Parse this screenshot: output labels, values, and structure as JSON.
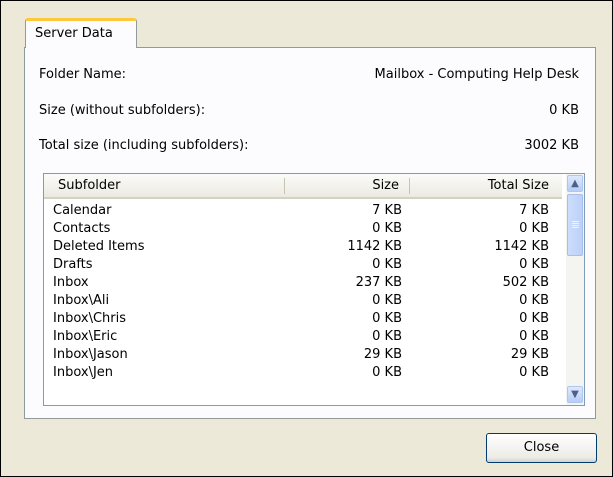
{
  "tab": {
    "label": "Server Data"
  },
  "info": {
    "folder_name_label": "Folder Name:",
    "folder_name_value": "Mailbox - Computing Help Desk",
    "size_label": "Size (without subfolders):",
    "size_value": "0 KB",
    "total_size_label": "Total size (including subfolders):",
    "total_size_value": "3002 KB"
  },
  "table": {
    "headers": {
      "subfolder": "Subfolder",
      "size": "Size",
      "total_size": "Total Size"
    },
    "rows": [
      {
        "name": "Calendar",
        "size": "7 KB",
        "total": "7 KB"
      },
      {
        "name": "Contacts",
        "size": "0 KB",
        "total": "0 KB"
      },
      {
        "name": "Deleted Items",
        "size": "1142 KB",
        "total": "1142 KB"
      },
      {
        "name": "Drafts",
        "size": "0 KB",
        "total": "0 KB"
      },
      {
        "name": "Inbox",
        "size": "237 KB",
        "total": "502 KB"
      },
      {
        "name": "Inbox\\Ali",
        "size": "0 KB",
        "total": "0 KB"
      },
      {
        "name": "Inbox\\Chris",
        "size": "0 KB",
        "total": "0 KB"
      },
      {
        "name": "Inbox\\Eric",
        "size": "0 KB",
        "total": "0 KB"
      },
      {
        "name": "Inbox\\Jason",
        "size": "29 KB",
        "total": "29 KB"
      },
      {
        "name": "Inbox\\Jen",
        "size": "0 KB",
        "total": "0 KB"
      }
    ]
  },
  "buttons": {
    "close": "Close"
  },
  "icons": {
    "scroll_up": "scroll-up-arrow-icon",
    "scroll_down": "scroll-down-arrow-icon"
  }
}
